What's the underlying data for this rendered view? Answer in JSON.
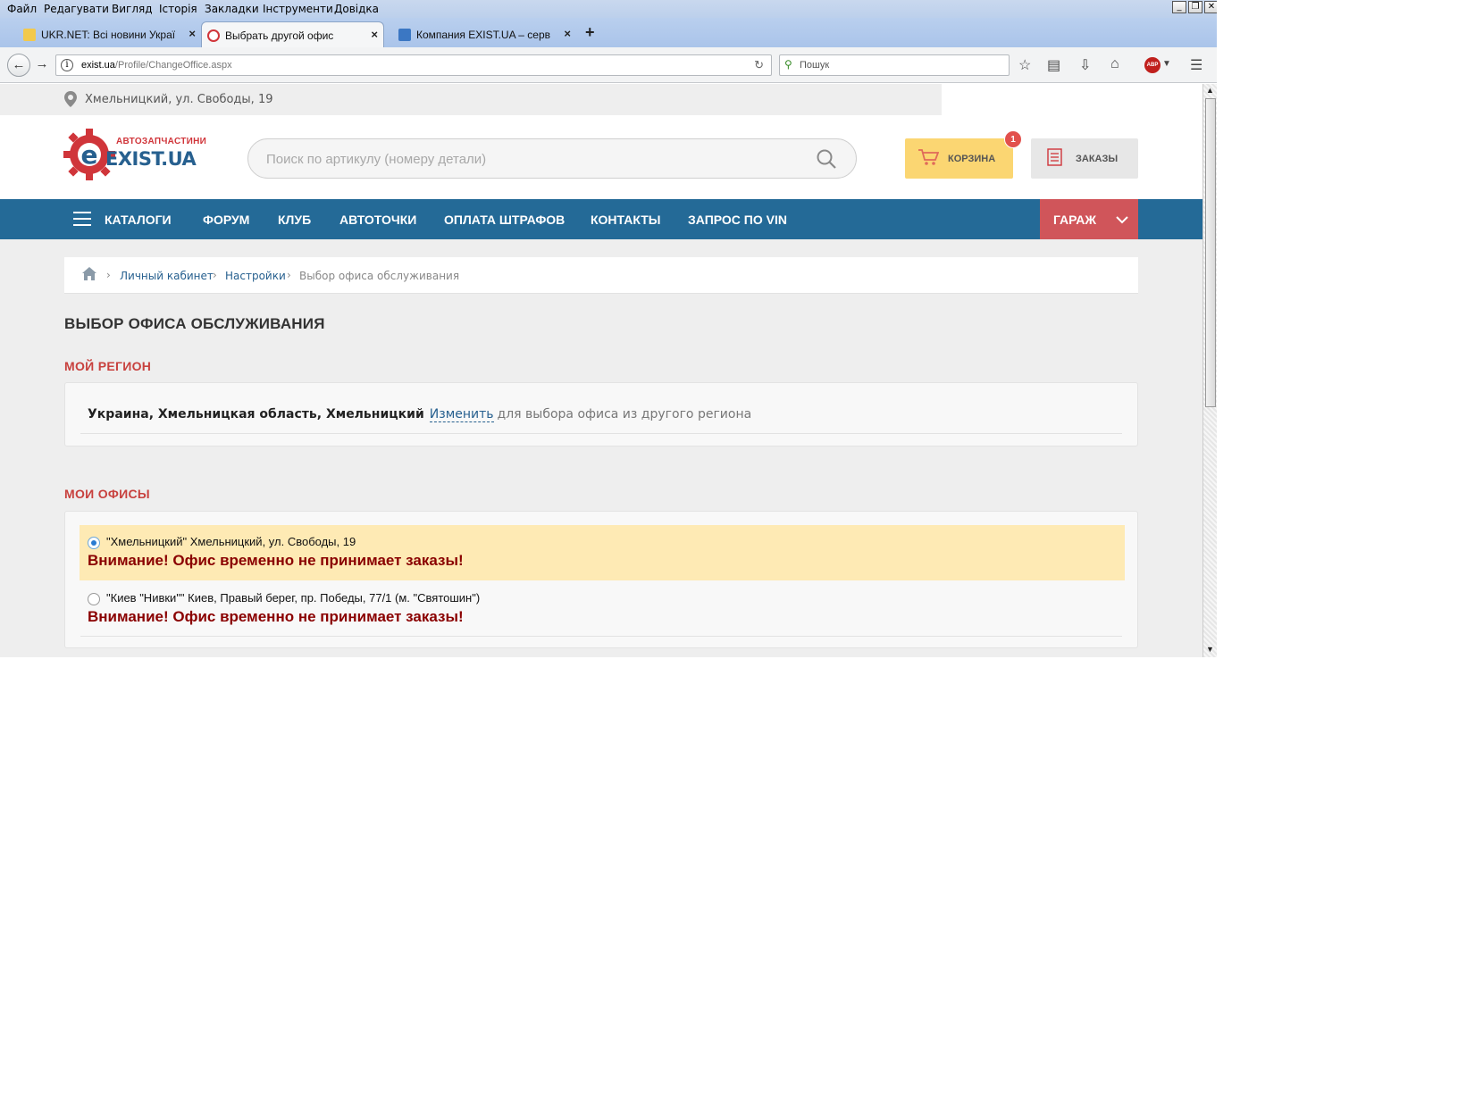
{
  "browser": {
    "menu": [
      "Файл",
      "Редагувати",
      "Вигляд",
      "Історія",
      "Закладки",
      "Інструменти",
      "Довідка"
    ],
    "tabs": [
      {
        "title": "UKR.NET: Всі новини Україн...",
        "close": "×"
      },
      {
        "title": "Выбрать другой офис",
        "close": "×"
      },
      {
        "title": "Компания EXIST.UA – серви...",
        "close": "×"
      }
    ],
    "new_tab": "+",
    "url_host": "exist.ua",
    "url_path": "/Profile/ChangeOffice.aspx",
    "search_placeholder": "Пошук",
    "adblock_label": "ABP"
  },
  "site": {
    "location": "Хмельницкий, ул. Свободы, 19",
    "logo": {
      "tagline": "АВТОЗАПЧАСТИНИ",
      "word": "EXIST.UA"
    },
    "search_placeholder": "Поиск по артикулу (номеру детали)",
    "cart": {
      "label": "КОРЗИНА",
      "count": "1"
    },
    "orders_label": "ЗАКАЗЫ",
    "nav": {
      "catalogs": "КАТАЛОГИ",
      "forum": "ФОРУМ",
      "club": "КЛУБ",
      "autopoints": "АВТОТОЧКИ",
      "fines": "ОПЛАТА ШТРАФОВ",
      "contacts": "КОНТАКТЫ",
      "vin": "ЗАПРОС ПО VIN",
      "garage": "ГАРАЖ"
    },
    "breadcrumbs": {
      "cabinet": "Личный кабинет",
      "settings": "Настройки",
      "current": "Выбор офиса обслуживания"
    },
    "page_title": "ВЫБОР ОФИСА ОБСЛУЖИВАНИЯ",
    "region": {
      "heading": "МОЙ РЕГИОН",
      "value": "Украина, Хмельницкая область, Хмельницкий",
      "change_link": "Изменить",
      "hint": "для выбора офиса из другого региона"
    },
    "offices": {
      "heading": "МОИ ОФИСЫ",
      "items": [
        {
          "name": "\"Хмельницкий\" Хмельницкий, ул. Свободы, 19",
          "warning": "Внимание! Офис временно не принимает заказы!",
          "selected": true
        },
        {
          "name": "\"Киев \"Нивки\"\" Киев, Правый берег, пр. Победы, 77/1 (м. \"Святошин\")",
          "warning": "Внимание! Офис временно не принимает заказы!",
          "selected": false
        }
      ]
    }
  },
  "colors": {
    "nav_blue": "#246a97",
    "garage_red": "#d0555a",
    "section_red": "#c8413e",
    "warning_dark_red": "#8a0000",
    "selected_row": "#feeab4",
    "cart_yellow": "#fbd672"
  }
}
